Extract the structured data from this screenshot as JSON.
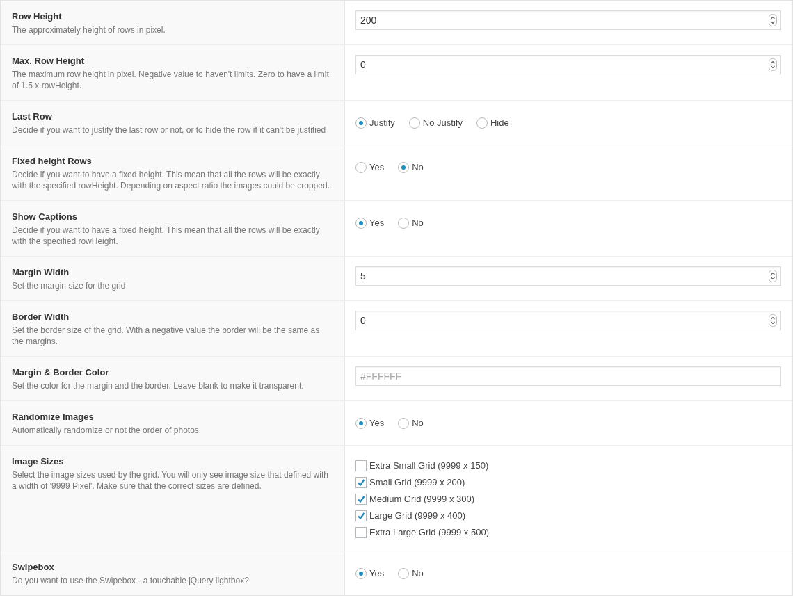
{
  "settings": [
    {
      "title": "Row Height",
      "description": "The approximately height of rows in pixel.",
      "kind": "number",
      "value": "200"
    },
    {
      "title": "Max. Row Height",
      "description": "The maximum row height in pixel. Negative value to haven't limits. Zero to have a limit of 1.5 x rowHeight.",
      "kind": "number",
      "value": "0"
    },
    {
      "title": "Last Row",
      "description": "Decide if you want to justify the last row or not, or to hide the row if it can't be justified",
      "kind": "radio",
      "options": [
        {
          "label": "Justify",
          "selected": true
        },
        {
          "label": "No Justify",
          "selected": false
        },
        {
          "label": "Hide",
          "selected": false
        }
      ]
    },
    {
      "title": "Fixed height Rows",
      "description": "Decide if you want to have a fixed height. This mean that all the rows will be exactly with the specified rowHeight. Depending on aspect ratio the images could be cropped.",
      "kind": "radio",
      "options": [
        {
          "label": "Yes",
          "selected": false
        },
        {
          "label": "No",
          "selected": true
        }
      ]
    },
    {
      "title": "Show Captions",
      "description": "Decide if you want to have a fixed height. This mean that all the rows will be exactly with the specified rowHeight.",
      "kind": "radio",
      "options": [
        {
          "label": "Yes",
          "selected": true
        },
        {
          "label": "No",
          "selected": false
        }
      ]
    },
    {
      "title": "Margin Width",
      "description": "Set the margin size for the grid",
      "kind": "number",
      "value": "5"
    },
    {
      "title": "Border Width",
      "description": "Set the border size of the grid. With a negative value the border will be the same as the margins.",
      "kind": "number",
      "value": "0"
    },
    {
      "title": "Margin & Border Color",
      "description": "Set the color for the margin and the border. Leave blank to make it transparent.",
      "kind": "text",
      "placeholder": "#FFFFFF"
    },
    {
      "title": "Randomize Images",
      "description": "Automatically randomize or not the order of photos.",
      "kind": "radio",
      "options": [
        {
          "label": "Yes",
          "selected": true
        },
        {
          "label": "No",
          "selected": false
        }
      ]
    },
    {
      "title": "Image Sizes",
      "description": "Select the image sizes used by the grid. You will only see image size that defined with a width of '9999 Pixel'. Make sure that the correct sizes are defined.",
      "kind": "checkboxes",
      "options": [
        {
          "label": "Extra Small Grid (9999 x 150)",
          "checked": false
        },
        {
          "label": "Small Grid (9999 x 200)",
          "checked": true
        },
        {
          "label": "Medium Grid (9999 x 300)",
          "checked": true
        },
        {
          "label": "Large Grid (9999 x 400)",
          "checked": true
        },
        {
          "label": "Extra Large Grid (9999 x 500)",
          "checked": false
        }
      ]
    },
    {
      "title": "Swipebox",
      "description": "Do you want to use the Swipebox - a touchable jQuery lightbox?",
      "kind": "radio",
      "options": [
        {
          "label": "Yes",
          "selected": true
        },
        {
          "label": "No",
          "selected": false
        }
      ]
    }
  ]
}
